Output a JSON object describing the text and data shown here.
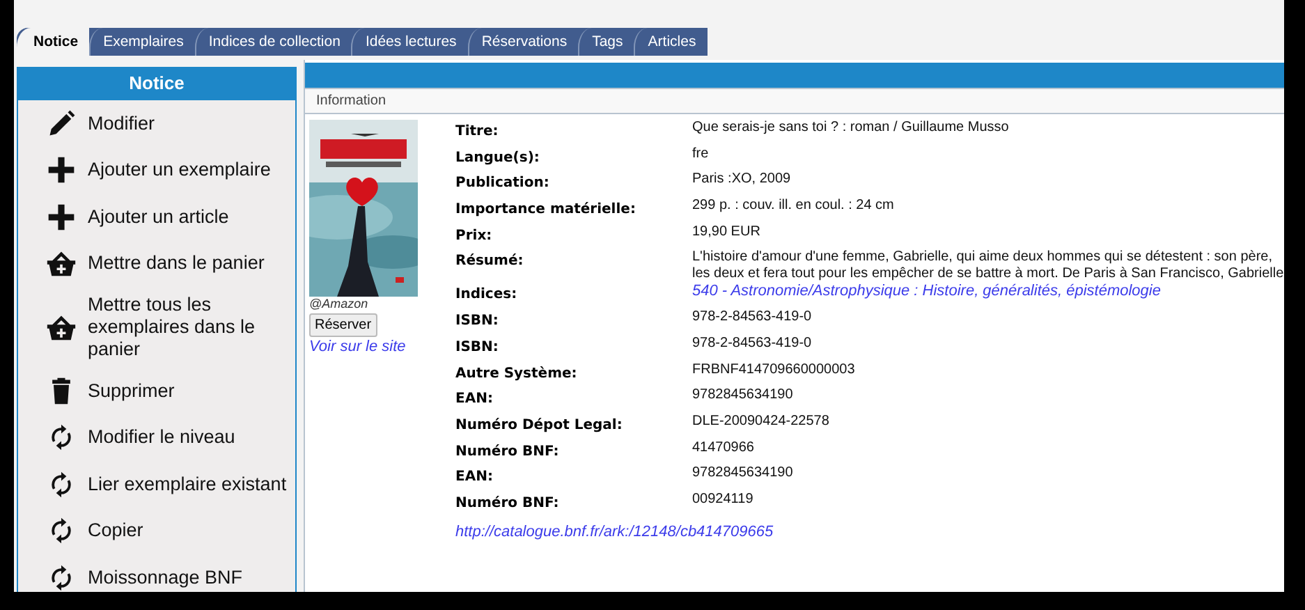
{
  "tabs": [
    {
      "label": "Notice",
      "selected": true
    },
    {
      "label": "Exemplaires",
      "selected": false
    },
    {
      "label": "Indices de collection",
      "selected": false
    },
    {
      "label": "Idées lectures",
      "selected": false
    },
    {
      "label": "Réservations",
      "selected": false
    },
    {
      "label": "Tags",
      "selected": false
    },
    {
      "label": "Articles",
      "selected": false
    }
  ],
  "sidebar": {
    "title": "Notice",
    "items": [
      {
        "kind": "edit",
        "label": "Modifier"
      },
      {
        "kind": "add",
        "label": "Ajouter un exemplaire"
      },
      {
        "kind": "add",
        "label": "Ajouter un article"
      },
      {
        "kind": "basket",
        "label": "Mettre dans le panier"
      },
      {
        "kind": "basket",
        "label": "Mettre tous les exemplaires dans le panier"
      },
      {
        "kind": "delete",
        "label": "Supprimer"
      },
      {
        "kind": "sync",
        "label": "Modifier le niveau"
      },
      {
        "kind": "sync",
        "label": "Lier exemplaire existant"
      },
      {
        "kind": "sync",
        "label": "Copier"
      },
      {
        "kind": "sync",
        "label": "Moissonnage BNF"
      }
    ]
  },
  "panel": {
    "section": "Information",
    "cover": {
      "kind": "picture",
      "credit": "@Amazon",
      "button": "Réserver",
      "link": "Voir sur le site"
    },
    "fields": [
      {
        "kind": "text",
        "label": "Titre:",
        "value": "Que serais-je sans toi ? : roman / Guillaume Musso"
      },
      {
        "kind": "text",
        "label": "Langue(s):",
        "value": "fre"
      },
      {
        "kind": "text",
        "label": "Publication:",
        "value": "Paris :XO, 2009"
      },
      {
        "kind": "text",
        "label": "Importance matérielle:",
        "value": "299 p. : couv. ill. en coul. : 24 cm"
      },
      {
        "kind": "text",
        "label": "Prix:",
        "value": "19,90 EUR"
      },
      {
        "kind": "lines",
        "label": "Résumé:",
        "lines": [
          "L'histoire d'amour d'une femme, Gabrielle, qui aime deux hommes qui se détestent : son père,",
          "les deux et fera tout pour les empêcher de se battre à mort. De Paris à San Francisco, Gabrielle"
        ]
      },
      {
        "kind": "link",
        "label": "Indices:",
        "value": "540 - Astronomie/Astrophysique : Histoire, généralités, épistémologie"
      },
      {
        "kind": "text",
        "label": "ISBN:",
        "value": "978-2-84563-419-0"
      },
      {
        "kind": "text",
        "label": "ISBN:",
        "value": "978-2-84563-419-0"
      },
      {
        "kind": "text",
        "label": "Autre Système:",
        "value": "FRBNF414709660000003"
      },
      {
        "kind": "text",
        "label": "EAN:",
        "value": "9782845634190"
      },
      {
        "kind": "text",
        "label": "Numéro Dépot Legal:",
        "value": "DLE-20090424-22578"
      },
      {
        "kind": "text",
        "label": "Numéro BNF:",
        "value": "41470966"
      },
      {
        "kind": "text",
        "label": "EAN:",
        "value": "9782845634190"
      },
      {
        "kind": "text",
        "label": "Numéro BNF:",
        "value": "00924119"
      }
    ],
    "url": "http://catalogue.bnf.fr/ark:/12148/cb414709665"
  }
}
